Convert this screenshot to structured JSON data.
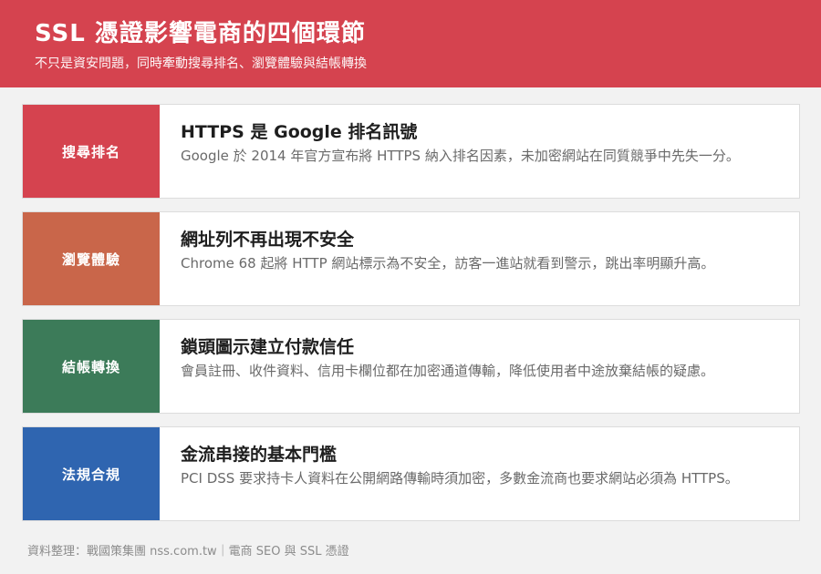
{
  "header": {
    "title": "SSL 憑證影響電商的四個環節",
    "subtitle": "不只是資安問題，同時牽動搜尋排名、瀏覽體驗與結帳轉換",
    "color": "#d5434f"
  },
  "cards": [
    {
      "tag": "搜尋排名",
      "color": "#d5434f",
      "heading": "HTTPS 是 Google 排名訊號",
      "description": "Google 於 2014 年官方宣布將 HTTPS 納入排名因素，未加密網站在同質競爭中先失一分。"
    },
    {
      "tag": "瀏覽體驗",
      "color": "#c9664a",
      "heading": "網址列不再出現不安全",
      "description": "Chrome 68 起將 HTTP 網站標示為不安全，訪客一進站就看到警示，跳出率明顯升高。"
    },
    {
      "tag": "結帳轉換",
      "color": "#3c7b59",
      "heading": "鎖頭圖示建立付款信任",
      "description": "會員註冊、收件資料、信用卡欄位都在加密通道傳輸，降低使用者中途放棄結帳的疑慮。"
    },
    {
      "tag": "法規合規",
      "color": "#2f65b0",
      "heading": "金流串接的基本門檻",
      "description": "PCI DSS 要求持卡人資料在公開網路傳輸時須加密，多數金流商也要求網站必須為 HTTPS。"
    }
  ],
  "footer": {
    "text": "資料整理：戰國策集團 nss.com.tw｜電商 SEO 與 SSL 憑證"
  }
}
